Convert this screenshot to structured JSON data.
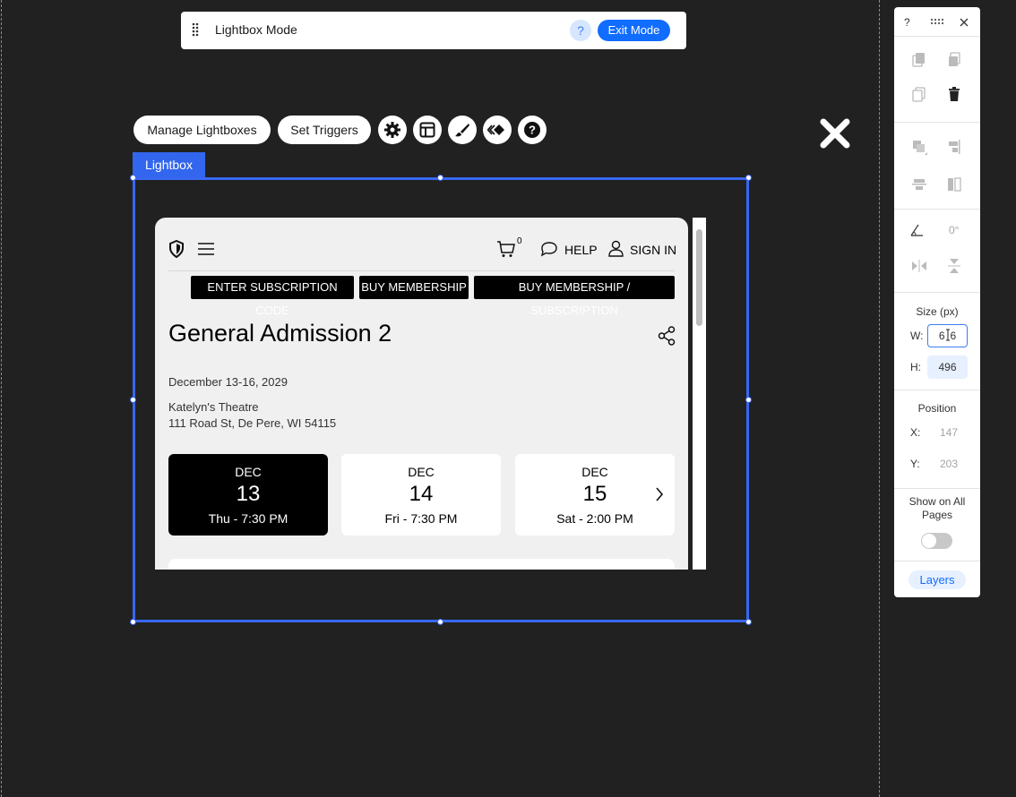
{
  "mode_bar": {
    "title": "Lightbox Mode",
    "help_label": "?",
    "exit_label": "Exit Mode"
  },
  "toolbar": {
    "manage_label": "Manage Lightboxes",
    "triggers_label": "Set Triggers",
    "icons": [
      "gear-icon",
      "layout-icon",
      "brush-icon",
      "animation-icon",
      "help-icon"
    ]
  },
  "lightbox": {
    "tag_label": "Lightbox"
  },
  "site_page": {
    "cart_count": "0",
    "help_label": "HELP",
    "sign_in_label": "SIGN IN",
    "buttons": [
      "ENTER SUBSCRIPTION CODE",
      "BUY MEMBERSHIP",
      "BUY MEMBERSHIP / SUBSCRIPTION"
    ],
    "event_title": "General Admission 2",
    "event_dates": "December 13-16, 2029",
    "venue_name": "Katelyn's Theatre",
    "venue_address": "111 Road St, De Pere, WI 54115",
    "date_cards": [
      {
        "month": "DEC",
        "day": "13",
        "time": "Thu - 7:30 PM",
        "selected": true
      },
      {
        "month": "DEC",
        "day": "14",
        "time": "Fri - 7:30 PM",
        "selected": false
      },
      {
        "month": "DEC",
        "day": "15",
        "time": "Sat - 2:00 PM",
        "selected": false
      }
    ]
  },
  "panel": {
    "help_label": "?",
    "size_label": "Size (px)",
    "w_label": "W:",
    "w_value": "6",
    "w_value_tail": "6",
    "h_label": "H:",
    "h_value": "496",
    "position_label": "Position",
    "x_label": "X:",
    "x_value": "147",
    "y_label": "Y:",
    "y_value": "203",
    "rotation_value": "0°",
    "show_all_line1": "Show on All",
    "show_all_line2": "Pages",
    "show_all_on": false,
    "layers_label": "Layers"
  },
  "colors": {
    "canvas": "#212121",
    "accent": "#116dff",
    "selection": "#3868f0"
  }
}
